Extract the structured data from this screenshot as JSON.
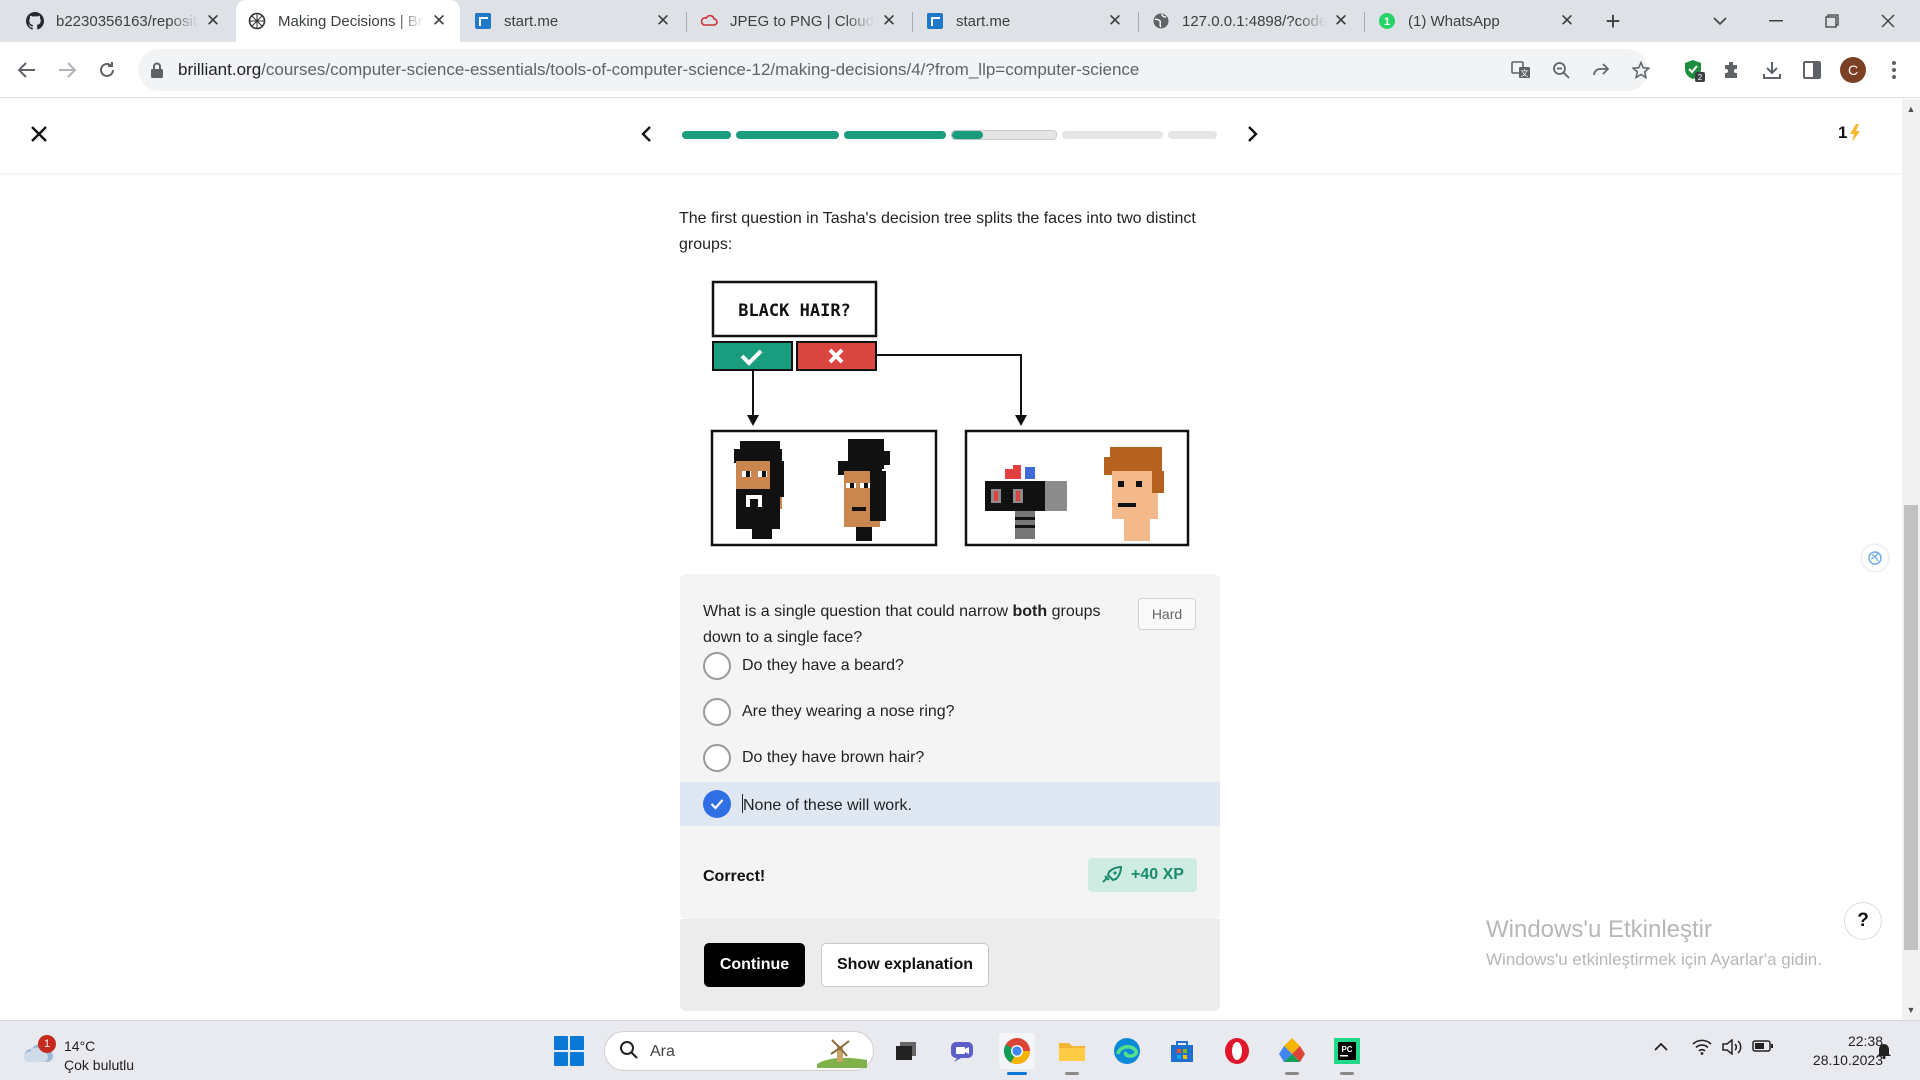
{
  "browser": {
    "tabs": [
      {
        "title": "b2230356163/reposit",
        "icon": "github-icon",
        "active": false
      },
      {
        "title": "Making Decisions | Br",
        "icon": "brilliant-icon",
        "active": true
      },
      {
        "title": "start.me",
        "icon": "startme-icon",
        "active": false
      },
      {
        "title": "JPEG to PNG | Cloud",
        "icon": "cloudconvert-icon",
        "active": false
      },
      {
        "title": "start.me",
        "icon": "startme-icon",
        "active": false
      },
      {
        "title": "127.0.0.1:4898/?code",
        "icon": "globe-icon",
        "active": false
      },
      {
        "title": "(1) WhatsApp",
        "icon": "whatsapp-icon",
        "active": false
      }
    ],
    "url_domain": "brilliant.org",
    "url_path": "/courses/computer-science-essentials/tools-of-computer-science-12/making-decisions/4/?from_llp=computer-science",
    "profile_initial": "C",
    "extension_badge": "2"
  },
  "lesson": {
    "progress": [
      1,
      1,
      1,
      0.3,
      0,
      0
    ],
    "streak": "1",
    "intro": "The first question in Tasha's decision tree splits the faces into two distinct groups:",
    "diagram": {
      "question": "BLACK HAIR?",
      "yes_color": "#1a9c7e",
      "no_color": "#d9453f"
    },
    "question_pre": "What is a single question that could narrow ",
    "question_bold": "both",
    "question_post": " groups down to a single face?",
    "difficulty": "Hard",
    "options": [
      {
        "label": "Do they have a beard?",
        "selected": false
      },
      {
        "label": "Are they wearing a nose ring?",
        "selected": false
      },
      {
        "label": "Do they have brown hair?",
        "selected": false
      },
      {
        "label": "None of these will work.",
        "selected": true
      }
    ],
    "result": "Correct!",
    "xp": "+40 XP",
    "continue_label": "Continue",
    "explanation_label": "Show explanation",
    "help_label": "?"
  },
  "watermark": {
    "title": "Windows'u Etkinleştir",
    "subtitle": "Windows'u etkinleştirmek için Ayarlar'a gidin."
  },
  "taskbar": {
    "weather_temp": "14°C",
    "weather_cond": "Çok bulutlu",
    "weather_badge": "1",
    "search_placeholder": "Ara",
    "time": "22:38",
    "date": "28.10.2023"
  }
}
